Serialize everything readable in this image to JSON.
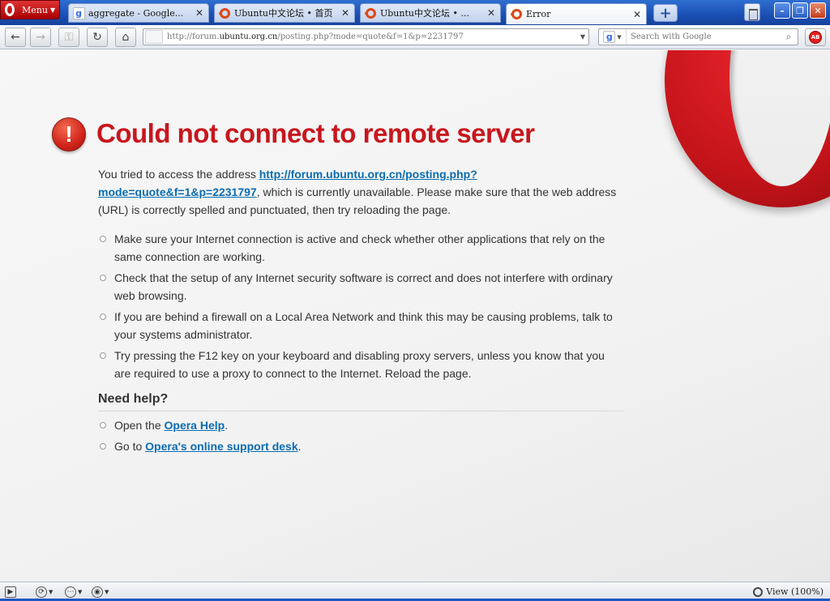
{
  "browser": {
    "menu_label": "Menu",
    "tabs": [
      {
        "title": "aggregate - Google...",
        "icon": "google-icon",
        "active": false
      },
      {
        "title": "Ubuntu中文论坛 • 首页",
        "icon": "ubuntu-icon",
        "active": false
      },
      {
        "title": "Ubuntu中文论坛 • ...",
        "icon": "ubuntu-icon",
        "active": false
      },
      {
        "title": "Error",
        "icon": "ubuntu-icon",
        "active": true
      }
    ],
    "new_tab_label": "+",
    "window_buttons": {
      "minimize": "–",
      "restore": "❐",
      "close": "✕"
    }
  },
  "toolbar": {
    "back": "←",
    "forward": "→",
    "reload": "↻",
    "home": "⌂",
    "url_prefix": "http://forum.",
    "url_host": "ubuntu.org.cn",
    "url_path": "/posting.php?mode=quote&f=1&p=2231797",
    "search_placeholder": "Search with Google",
    "adblock_label": "AB"
  },
  "page": {
    "title": "Could not connect to remote server",
    "intro_before": "You tried to access the address ",
    "intro_link": "http://forum.ubuntu.org.cn/posting.php?mode=quote&f=1&p=2231797",
    "intro_after": ", which is currently unavailable. Please make sure that the web address (URL) is correctly spelled and punctuated, then try reloading the page.",
    "tips": [
      "Make sure your Internet connection is active and check whether other applications that rely on the same connection are working.",
      "Check that the setup of any Internet security software is correct and does not interfere with ordinary web browsing.",
      "If you are behind a firewall on a Local Area Network and think this may be causing problems, talk to your systems administrator.",
      "Try pressing the F12 key on your keyboard and disabling proxy servers, unless you know that you are required to use a proxy to connect to the Internet. Reload the page."
    ],
    "help_heading": "Need help?",
    "help_items": [
      {
        "before": "Open the ",
        "link": "Opera Help",
        "after": "."
      },
      {
        "before": "Go to ",
        "link": "Opera's online support desk",
        "after": "."
      }
    ]
  },
  "statusbar": {
    "zoom_label": "View (100%)"
  },
  "colors": {
    "title_red": "#c8161d",
    "link_blue": "#0a6cb0",
    "tabstrip_blue": "#1b4fb4"
  }
}
